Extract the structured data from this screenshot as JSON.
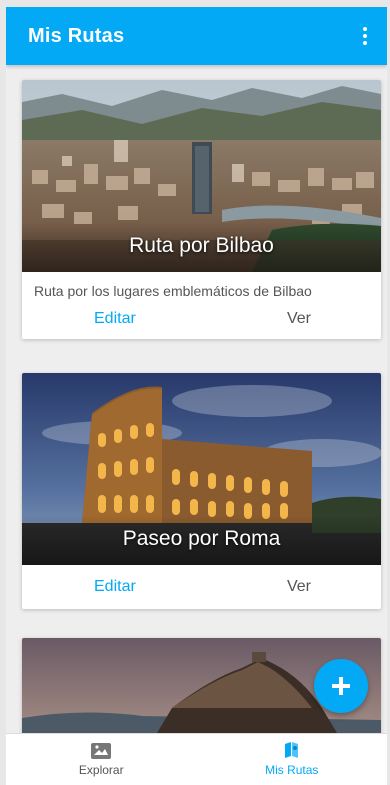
{
  "appbar": {
    "title": "Mis Rutas",
    "menu_icon": "more-vert-icon"
  },
  "routes": [
    {
      "title": "Ruta por Bilbao",
      "description": "Ruta por los lugares emblemáticos de Bilbao",
      "edit_label": "Editar",
      "view_label": "Ver"
    },
    {
      "title": "Paseo por Roma",
      "description": "",
      "edit_label": "Editar",
      "view_label": "Ver"
    },
    {
      "title": "",
      "description": ""
    }
  ],
  "fab": {
    "icon": "plus-icon"
  },
  "bottom_nav": {
    "items": [
      {
        "label": "Explorar",
        "icon": "explore-map-icon",
        "active": false
      },
      {
        "label": "Mis Rutas",
        "icon": "my-routes-icon",
        "active": true
      }
    ]
  },
  "colors": {
    "primary": "#03a9f4",
    "background": "#eeeeee",
    "text": "#555555"
  }
}
